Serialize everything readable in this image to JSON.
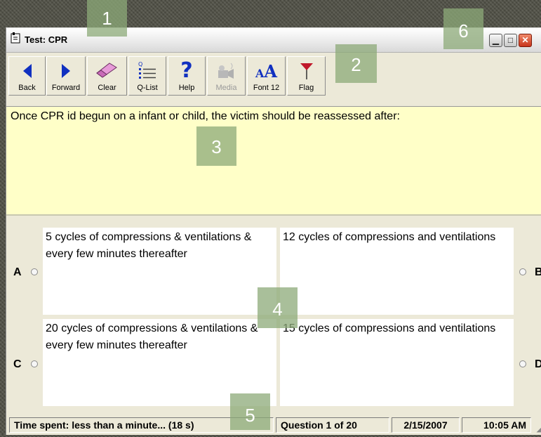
{
  "window": {
    "title": "Test: CPR",
    "app_icon": "document-icon",
    "minimize_glyph": "▁",
    "maximize_glyph": "□",
    "close_glyph": "✕"
  },
  "toolbar": {
    "items": [
      {
        "label": "Back",
        "icon": "arrow-left-icon",
        "enabled": true
      },
      {
        "label": "Forward",
        "icon": "arrow-right-icon",
        "enabled": true
      },
      {
        "label": "Clear",
        "icon": "eraser-icon",
        "enabled": true
      },
      {
        "label": "Q-List",
        "icon": "list-icon",
        "enabled": true
      },
      {
        "label": "Help",
        "icon": "help-icon",
        "enabled": true
      },
      {
        "label": "Media",
        "icon": "media-icon",
        "enabled": false
      },
      {
        "label": "Font 12",
        "icon": "font-icon",
        "enabled": true
      },
      {
        "label": "Flag",
        "icon": "flag-icon",
        "enabled": true
      }
    ]
  },
  "question": {
    "text": "Once CPR id begun on a infant or child, the victim should be reassessed after:"
  },
  "answers": {
    "a": {
      "letter": "A",
      "text": "5 cycles of compressions & ventilations & every few minutes thereafter"
    },
    "b": {
      "letter": "B",
      "text": "12 cycles of compressions and ventilations"
    },
    "c": {
      "letter": "C",
      "text": "20 cycles of compressions & ventilations & every few minutes thereafter"
    },
    "d": {
      "letter": "D",
      "text": "15 cycles of compressions and ventilations"
    }
  },
  "status": {
    "time_spent": "Time spent: less than a minute... (18 s)",
    "question_progress": "Question 1 of 20",
    "date": "2/15/2007",
    "time": "10:05 AM"
  },
  "callouts": {
    "one": "1",
    "two": "2",
    "three": "3",
    "four": "4",
    "five": "5",
    "six": "6"
  },
  "colors": {
    "question_bg": "#ffffc8",
    "arrow_blue": "#1030c0",
    "callout_green": "#8caa78"
  }
}
